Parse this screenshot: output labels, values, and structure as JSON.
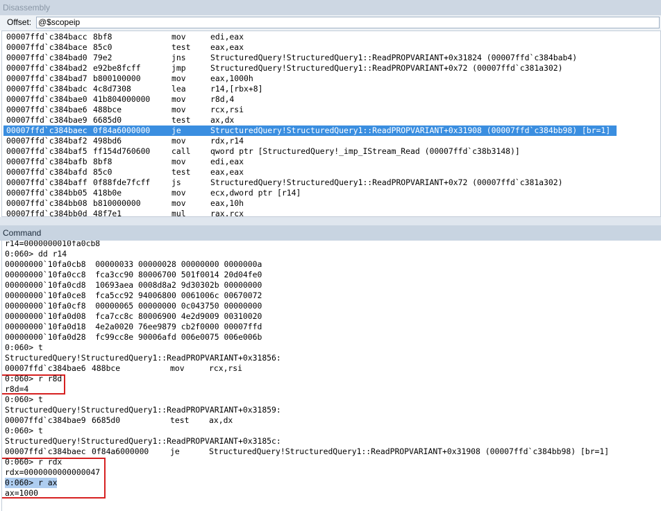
{
  "disassembly": {
    "title": "Disassembly",
    "offset_label": "Offset:",
    "offset_value": "@$scopeip",
    "lines": [
      {
        "addr": "00007ffd`c384bacc",
        "bytes": "8bf8",
        "mnem": "mov",
        "ops": "edi,eax"
      },
      {
        "addr": "00007ffd`c384bace",
        "bytes": "85c0",
        "mnem": "test",
        "ops": "eax,eax"
      },
      {
        "addr": "00007ffd`c384bad0",
        "bytes": "79e2",
        "mnem": "jns",
        "ops": "StructuredQuery!StructuredQuery1::ReadPROPVARIANT+0x31824 (00007ffd`c384bab4)"
      },
      {
        "addr": "00007ffd`c384bad2",
        "bytes": "e92be8fcff",
        "mnem": "jmp",
        "ops": "StructuredQuery!StructuredQuery1::ReadPROPVARIANT+0x72 (00007ffd`c381a302)"
      },
      {
        "addr": "00007ffd`c384bad7",
        "bytes": "b800100000",
        "mnem": "mov",
        "ops": "eax,1000h"
      },
      {
        "addr": "00007ffd`c384badc",
        "bytes": "4c8d7308",
        "mnem": "lea",
        "ops": "r14,[rbx+8]"
      },
      {
        "addr": "00007ffd`c384bae0",
        "bytes": "41b804000000",
        "mnem": "mov",
        "ops": "r8d,4"
      },
      {
        "addr": "00007ffd`c384bae6",
        "bytes": "488bce",
        "mnem": "mov",
        "ops": "rcx,rsi"
      },
      {
        "addr": "00007ffd`c384bae9",
        "bytes": "6685d0",
        "mnem": "test",
        "ops": "ax,dx"
      },
      {
        "addr": "00007ffd`c384baec",
        "bytes": "0f84a6000000",
        "mnem": "je",
        "ops": "StructuredQuery!StructuredQuery1::ReadPROPVARIANT+0x31908 (00007ffd`c384bb98) [br=1]",
        "selected": true
      },
      {
        "addr": "00007ffd`c384baf2",
        "bytes": "498bd6",
        "mnem": "mov",
        "ops": "rdx,r14"
      },
      {
        "addr": "00007ffd`c384baf5",
        "bytes": "ff154d760600",
        "mnem": "call",
        "ops": "qword ptr [StructuredQuery!_imp_IStream_Read (00007ffd`c38b3148)]"
      },
      {
        "addr": "00007ffd`c384bafb",
        "bytes": "8bf8",
        "mnem": "mov",
        "ops": "edi,eax"
      },
      {
        "addr": "00007ffd`c384bafd",
        "bytes": "85c0",
        "mnem": "test",
        "ops": "eax,eax"
      },
      {
        "addr": "00007ffd`c384baff",
        "bytes": "0f88fde7fcff",
        "mnem": "js",
        "ops": "StructuredQuery!StructuredQuery1::ReadPROPVARIANT+0x72 (00007ffd`c381a302)"
      },
      {
        "addr": "00007ffd`c384bb05",
        "bytes": "418b0e",
        "mnem": "mov",
        "ops": "ecx,dword ptr [r14]"
      },
      {
        "addr": "00007ffd`c384bb08",
        "bytes": "b810000000",
        "mnem": "mov",
        "ops": "eax,10h"
      },
      {
        "addr": "00007ffd`c384bb0d",
        "bytes": "48f7e1",
        "mnem": "mul",
        "ops": "rax,rcx"
      }
    ]
  },
  "command": {
    "title": "Command",
    "lines": [
      "r14=000000001 0fa0cb8",
      "0:060> dd r14",
      "00000000`10fa0cb8  00000033 00000028 00000000 0000000a",
      "00000000`10fa0cc8  fca3cc90 80006700 501f0014 20d04fe0",
      "00000000`10fa0cd8  10693aea 0008d8a2 9d30302b 00000000",
      "00000000`10fa0ce8  fca5cc92 94006800 0061006c 00670072",
      "00000000`10fa0cf8  00000065 00000000 0c043750 00000000",
      "00000000`10fa0d08  fca7cc8c 80006900 4e2d9009 00310020",
      "00000000`10fa0d18  4e2a0020 76ee9879 cb2f0000 00007ffd",
      "00000000`10fa0d28  fc99cc8e 90006afd 006e0075 006e006b",
      "0:060> t",
      "StructuredQuery!StructuredQuery1::ReadPROPVARIANT+0x31856:",
      {
        "addr": "00007ffd`c384bae6",
        "bytes": "488bce",
        "mnem": "mov",
        "ops": "rcx,rsi"
      },
      "0:060> r r8d",
      "r8d=4",
      "0:060> t",
      "StructuredQuery!StructuredQuery1::ReadPROPVARIANT+0x31859:",
      {
        "addr": "00007ffd`c384bae9",
        "bytes": "6685d0",
        "mnem": "test",
        "ops": "ax,dx"
      },
      "0:060> t",
      "StructuredQuery!StructuredQuery1::ReadPROPVARIANT+0x3185c:",
      {
        "addr": "00007ffd`c384baec",
        "bytes": "0f84a6000000",
        "mnem": "je",
        "ops": "StructuredQuery!StructuredQuery1::ReadPROPVARIANT+0x31908 (00007ffd`c384bb98) [br=1]"
      },
      "0:060> r rdx",
      "rdx=0000000000000047",
      "0:060> r ax",
      "ax=1000"
    ]
  },
  "colors": {
    "selection": "#3a8ee0",
    "command_highlight": "#aecdf0",
    "annotation_box": "#d62020",
    "title_bar": "#cdd7e3"
  }
}
